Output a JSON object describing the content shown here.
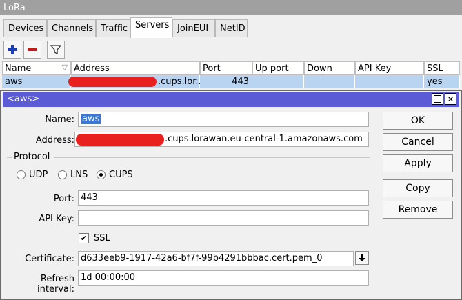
{
  "window_title": "LoRa",
  "tabs": [
    {
      "label": "Devices"
    },
    {
      "label": "Channels"
    },
    {
      "label": "Traffic"
    },
    {
      "label": "Servers"
    },
    {
      "label": "JoinEUI"
    },
    {
      "label": "NetID"
    }
  ],
  "active_tab": "Servers",
  "toolbar": {
    "add_icon": "plus-icon",
    "remove_icon": "minus-icon",
    "filter_icon": "filter-icon"
  },
  "table": {
    "columns": [
      "Name",
      "Address",
      "Port",
      "Up port",
      "Down port",
      "API Key",
      "SSL"
    ],
    "rows": [
      {
        "name": "aws",
        "address_suffix": ".cups.lor...",
        "port": "443",
        "up_port": "",
        "down_port": "",
        "api_key": "",
        "ssl": "yes"
      }
    ]
  },
  "dialog": {
    "title": "<aws>",
    "name_label": "Name:",
    "name_value": "aws",
    "address_label": "Address:",
    "address_suffix": ".cups.lorawan.eu-central-1.amazonaws.com",
    "protocol_label": "Protocol",
    "protocol_options": [
      "UDP",
      "LNS",
      "CUPS"
    ],
    "protocol_selected": "CUPS",
    "port_label": "Port:",
    "port_value": "443",
    "api_key_label": "API Key:",
    "api_key_value": "",
    "ssl_label": "SSL",
    "ssl_checked": true,
    "certificate_label": "Certificate:",
    "certificate_value": "d633eeb9-1917-42a6-bf7f-99b4291bbbac.cert.pem_0",
    "refresh_label": "Refresh interval:",
    "refresh_value": "1d 00:00:00",
    "buttons": {
      "ok": "OK",
      "cancel": "Cancel",
      "apply": "Apply",
      "copy": "Copy",
      "remove": "Remove"
    }
  },
  "colors": {
    "selected_row": "#b8d4f0",
    "dialog_title": "#5b5bd6",
    "redaction": "#e8201e"
  }
}
